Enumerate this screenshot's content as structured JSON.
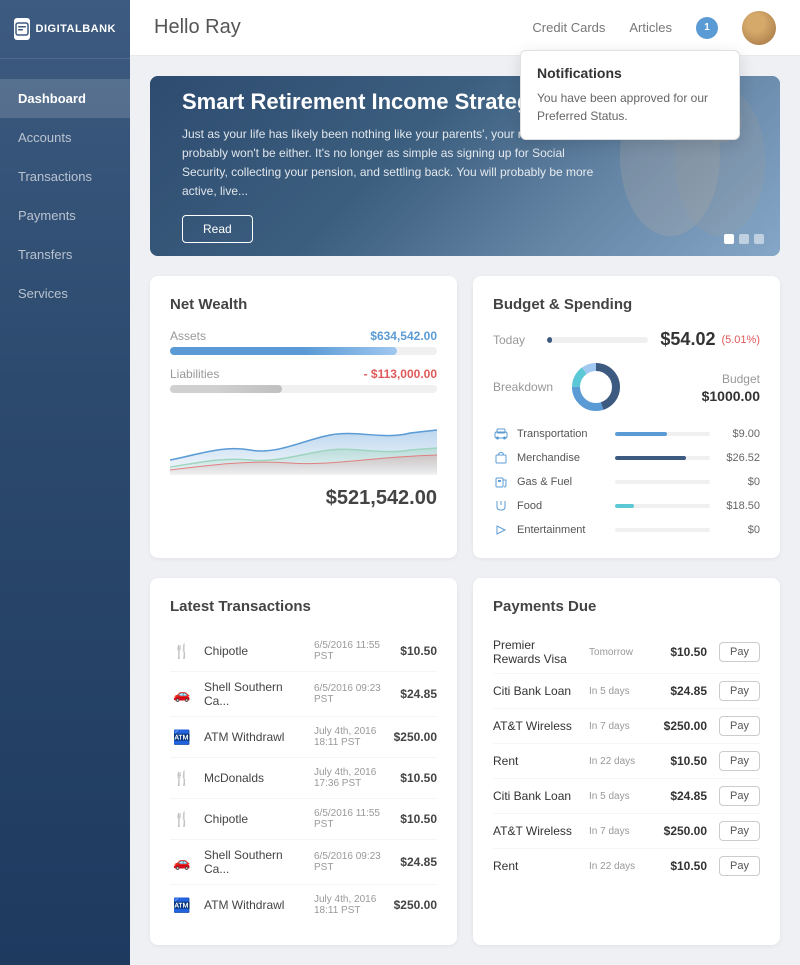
{
  "app": {
    "logo_text": "DIGITALBANK",
    "logo_short": "DB"
  },
  "sidebar": {
    "items": [
      {
        "label": "Dashboard",
        "active": true
      },
      {
        "label": "Accounts",
        "active": false
      },
      {
        "label": "Transactions",
        "active": false
      },
      {
        "label": "Payments",
        "active": false
      },
      {
        "label": "Transfers",
        "active": false
      },
      {
        "label": "Services",
        "active": false
      }
    ]
  },
  "header": {
    "greeting": "Hello Ray",
    "nav": [
      {
        "label": "Credit Cards"
      },
      {
        "label": "Articles"
      }
    ],
    "notification_count": "1",
    "notification_popup": {
      "title": "Notifications",
      "text": "You have been approved for our Preferred Status."
    }
  },
  "banner": {
    "title": "Smart Retirement Income Strategies",
    "text": "Just as your life has likely been nothing like your parents', your retirement probably won't be either. It's no longer as simple as signing up for Social Security, collecting your pension, and settling back. You will probably be more active, live...",
    "read_label": "Read",
    "dots": [
      true,
      false,
      false
    ]
  },
  "net_wealth": {
    "title": "Net Wealth",
    "assets_label": "Assets",
    "assets_value": "$634,542.00",
    "assets_bar_pct": 85,
    "liabilities_label": "Liabilities",
    "liabilities_value": "- $113,000.00",
    "liabilities_bar_pct": 42,
    "total": "$521,542.00"
  },
  "budget": {
    "title": "Budget & Spending",
    "today_label": "Today",
    "today_amount": "$54.02",
    "today_pct": "(5.01%)",
    "today_bar_pct": 5,
    "breakdown_label": "Breakdown",
    "budget_label": "Budget",
    "budget_amount": "$1000.00",
    "categories": [
      {
        "icon": "bus",
        "label": "Transportation",
        "bar_pct": 55,
        "value": "$9.00",
        "color": "#5b9bd5"
      },
      {
        "icon": "shop",
        "label": "Merchandise",
        "bar_pct": 75,
        "value": "$26.52",
        "color": "#3d5a80"
      },
      {
        "icon": "gas",
        "label": "Gas & Fuel",
        "bar_pct": 0,
        "value": "$0",
        "color": "#5b9bd5"
      },
      {
        "icon": "food",
        "label": "Food",
        "bar_pct": 20,
        "value": "$18.50",
        "color": "#5bc8d5"
      },
      {
        "icon": "music",
        "label": "Entertainment",
        "bar_pct": 0,
        "value": "$0",
        "color": "#5b9bd5"
      }
    ],
    "donut_segments": [
      {
        "pct": 45,
        "color": "#3d5a80"
      },
      {
        "pct": 30,
        "color": "#5b9bd5"
      },
      {
        "pct": 15,
        "color": "#5bc8d5"
      },
      {
        "pct": 10,
        "color": "#a0c8f0"
      }
    ]
  },
  "transactions": {
    "title": "Latest Transactions",
    "items": [
      {
        "icon": "food",
        "name": "Chipotle",
        "date": "6/5/2016 11:55 PST",
        "amount": "$10.50"
      },
      {
        "icon": "car",
        "name": "Shell Southern Ca...",
        "date": "6/5/2016 09:23 PST",
        "amount": "$24.85"
      },
      {
        "icon": "atm",
        "name": "ATM Withdrawl",
        "date": "July 4th, 2016 18:11 PST",
        "amount": "$250.00"
      },
      {
        "icon": "food",
        "name": "McDonalds",
        "date": "July 4th, 2016 17:36 PST",
        "amount": "$10.50"
      },
      {
        "icon": "food",
        "name": "Chipotle",
        "date": "6/5/2016 11:55 PST",
        "amount": "$10.50"
      },
      {
        "icon": "car",
        "name": "Shell Southern Ca...",
        "date": "6/5/2016 09:23 PST",
        "amount": "$24.85"
      },
      {
        "icon": "atm",
        "name": "ATM Withdrawl",
        "date": "July 4th, 2016 18:11 PST",
        "amount": "$250.00"
      }
    ]
  },
  "payments": {
    "title": "Payments Due",
    "pay_label": "Pay",
    "items": [
      {
        "name": "Premier Rewards Visa",
        "due": "Tomorrow",
        "amount": "$10.50"
      },
      {
        "name": "Citi Bank Loan",
        "due": "In 5 days",
        "amount": "$24.85"
      },
      {
        "name": "AT&T Wireless",
        "due": "In 7 days",
        "amount": "$250.00"
      },
      {
        "name": "Rent",
        "due": "In 22 days",
        "amount": "$10.50"
      },
      {
        "name": "Citi Bank Loan",
        "due": "In 5 days",
        "amount": "$24.85"
      },
      {
        "name": "AT&T Wireless",
        "due": "In 7 days",
        "amount": "$250.00"
      },
      {
        "name": "Rent",
        "due": "In 22 days",
        "amount": "$10.50"
      }
    ]
  }
}
